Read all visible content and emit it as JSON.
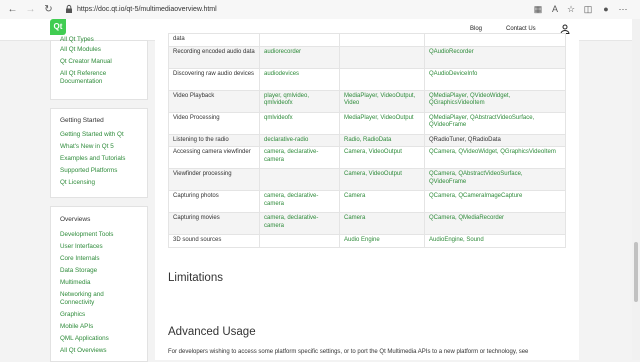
{
  "browser": {
    "url": "https://doc.qt.io/qt-5/multimediaoverview.html"
  },
  "header": {
    "logo": "Qt",
    "blog": "Blog",
    "contact": "Contact Us"
  },
  "sidebar_top": {
    "items": [
      "All Qt Types",
      "All Qt Modules",
      "Qt Creator Manual",
      "All Qt Reference",
      "Documentation"
    ]
  },
  "sidebar_started": {
    "heading": "Getting Started",
    "items": [
      "Getting Started with Qt",
      "What's New in Qt 5",
      "Examples and Tutorials",
      "Supported Platforms",
      "Qt Licensing"
    ]
  },
  "sidebar_overviews": {
    "heading": "Overviews",
    "items": [
      "Development Tools",
      "User Interfaces",
      "Core Internals",
      "Data Storage",
      "Multimedia",
      "Networking and",
      "Connectivity",
      "Graphics",
      "Mobile APIs",
      "QML Applications",
      "All Qt Overviews"
    ]
  },
  "table": {
    "rows": [
      [
        "data",
        "",
        "",
        ""
      ],
      [
        "Recording encoded audio data",
        "audiorecorder",
        "",
        "QAudioRecorder"
      ],
      [
        "Discovering raw audio devices",
        "audiodevices",
        "",
        "QAudioDeviceInfo"
      ],
      [
        "Video Playback",
        "player, qmlvideo, qmlvideofx",
        "MediaPlayer, VideoOutput, Video",
        "QMediaPlayer, QVideoWidget, QGraphicsVideoItem"
      ],
      [
        "Video Processing",
        "qmlvideofx",
        "MediaPlayer, VideoOutput",
        "QMediaPlayer, QAbstractVideoSurface, QVideoFrame"
      ],
      [
        "Listening to the radio",
        "declarative-radio",
        "Radio, RadioData",
        "QRadioTuner, QRadioData"
      ],
      [
        "Accessing camera viewfinder",
        "camera, declarative-camera",
        "Camera, VideoOutput",
        "QCamera, QVideoWidget, QGraphicsVideoItem"
      ],
      [
        "Viewfinder processing",
        "",
        "Camera, VideoOutput",
        "QCamera, QAbstractVideoSurface, QVideoFrame"
      ],
      [
        "Capturing photos",
        "camera, declarative-camera",
        "Camera",
        "QCamera, QCameraImageCapture"
      ],
      [
        "Capturing movies",
        "camera, declarative-camera",
        "Camera",
        "QCamera, QMediaRecorder"
      ],
      [
        "3D sound sources",
        "",
        "Audio Engine",
        "AudioEngine, Sound"
      ]
    ]
  },
  "sections": {
    "limitations": "Limitations",
    "advanced": "Advanced Usage",
    "advanced_text": "For developers wishing to access some platform specific settings, or to port the Qt Multimedia APIs to a new platform or technology, see"
  }
}
